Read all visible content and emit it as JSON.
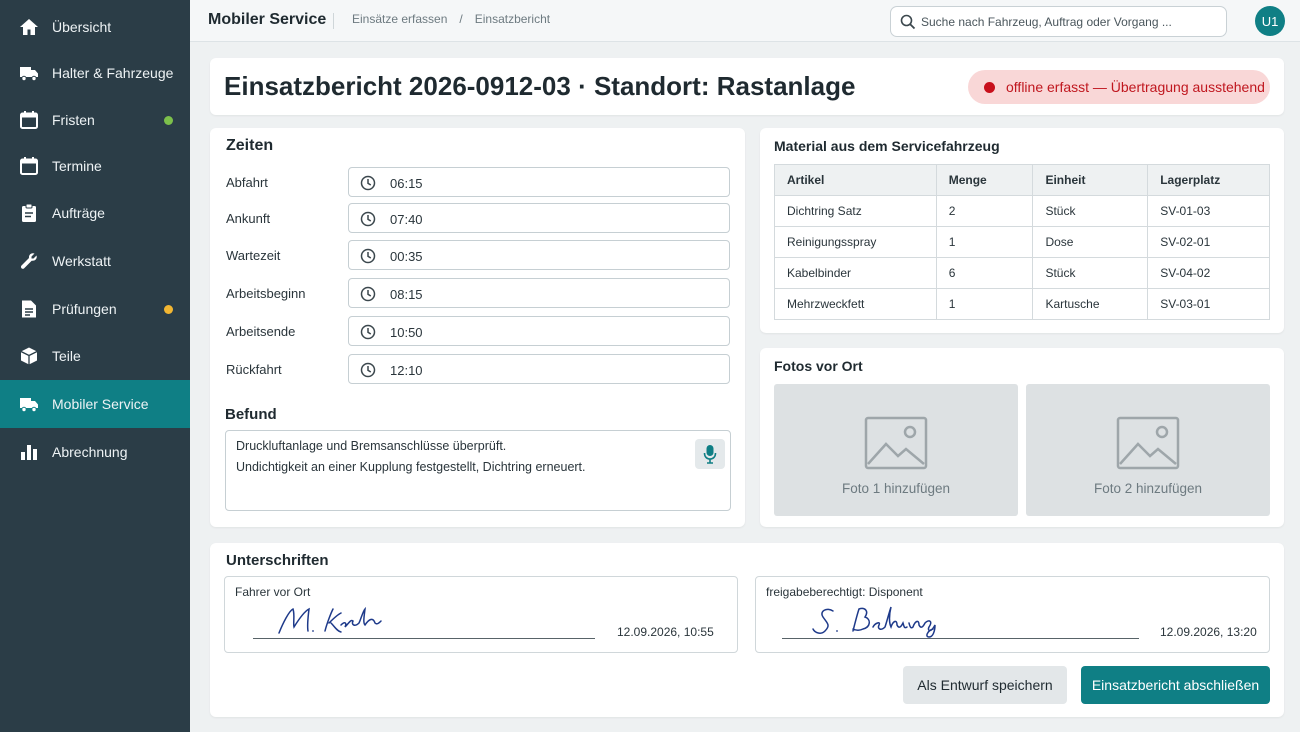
{
  "sidebar": {
    "items": [
      {
        "label": "Übersicht",
        "icon": "home-icon"
      },
      {
        "label": "Halter & Fahrzeuge",
        "icon": "truck-icon"
      },
      {
        "label": "Fristen",
        "icon": "calendar-icon",
        "dot_color": "#7cc04b"
      },
      {
        "label": "Termine",
        "icon": "calendar-icon"
      },
      {
        "label": "Aufträge",
        "icon": "clipboard-icon"
      },
      {
        "label": "Werkstatt",
        "icon": "wrench-icon"
      },
      {
        "label": "Prüfungen",
        "icon": "document-icon",
        "dot_color": "#f2b632"
      },
      {
        "label": "Teile",
        "icon": "box-icon"
      },
      {
        "label": "Mobiler Service",
        "icon": "truck-icon",
        "active": true
      },
      {
        "label": "Abrechnung",
        "icon": "bar-chart-icon"
      }
    ]
  },
  "header": {
    "title": "Mobiler Service",
    "breadcrumbs": [
      "Einsätze erfassen",
      "/",
      "Einsatzbericht"
    ],
    "search_placeholder": "Suche nach Fahrzeug, Auftrag oder Vorgang ...",
    "avatar_initials": "U1"
  },
  "report": {
    "title": "Einsatzbericht 2026-0912-03 · Standort: Rastanlage",
    "status": "offline erfasst — Übertragung ausstehend"
  },
  "zeiten": {
    "title": "Zeiten",
    "rows": [
      {
        "label": "Abfahrt",
        "value": "06:15"
      },
      {
        "label": "Ankunft",
        "value": "07:40"
      },
      {
        "label": "Wartezeit",
        "value": "00:35"
      },
      {
        "label": "Arbeitsbeginn",
        "value": "08:15"
      },
      {
        "label": "Arbeitsende",
        "value": "10:50"
      },
      {
        "label": "Rückfahrt",
        "value": "12:10"
      }
    ]
  },
  "befund": {
    "title": "Befund",
    "lines": [
      "Druckluftanlage und Bremsanschlüsse überprüft.",
      "Undichtigkeit an einer Kupplung festgestellt, Dichtring erneuert."
    ]
  },
  "material": {
    "title": "Material aus dem Servicefahrzeug",
    "columns": [
      "Artikel",
      "Menge",
      "Einheit",
      "Lagerplatz"
    ],
    "rows": [
      [
        "Dichtring Satz",
        "2",
        "Stück",
        "SV-01-03"
      ],
      [
        "Reinigungsspray",
        "1",
        "Dose",
        "SV-02-01"
      ],
      [
        "Kabelbinder",
        "6",
        "Stück",
        "SV-04-02"
      ],
      [
        "Mehrzweckfett",
        "1",
        "Kartusche",
        "SV-03-01"
      ]
    ]
  },
  "fotos": {
    "title": "Fotos vor Ort",
    "items": [
      "Foto 1 hinzufügen",
      "Foto 2 hinzufügen"
    ]
  },
  "unterschriften": {
    "title": "Unterschriften",
    "signers": [
      {
        "role": "Fahrer vor Ort",
        "signature": "M. Krah",
        "timestamp": "12.09.2026, 10:55"
      },
      {
        "role": "freigabeberechtigt: Disponent",
        "signature": "S. Behring",
        "timestamp": "12.09.2026, 13:20"
      }
    ]
  },
  "actions": {
    "draft": "Als Entwurf speichern",
    "finish": "Einsatzbericht abschließen"
  },
  "colors": {
    "sidebar_bg": "#2b3d47",
    "accent": "#0f7f85",
    "offline_bg": "#f9d7d7",
    "offline_text": "#c0171f"
  }
}
